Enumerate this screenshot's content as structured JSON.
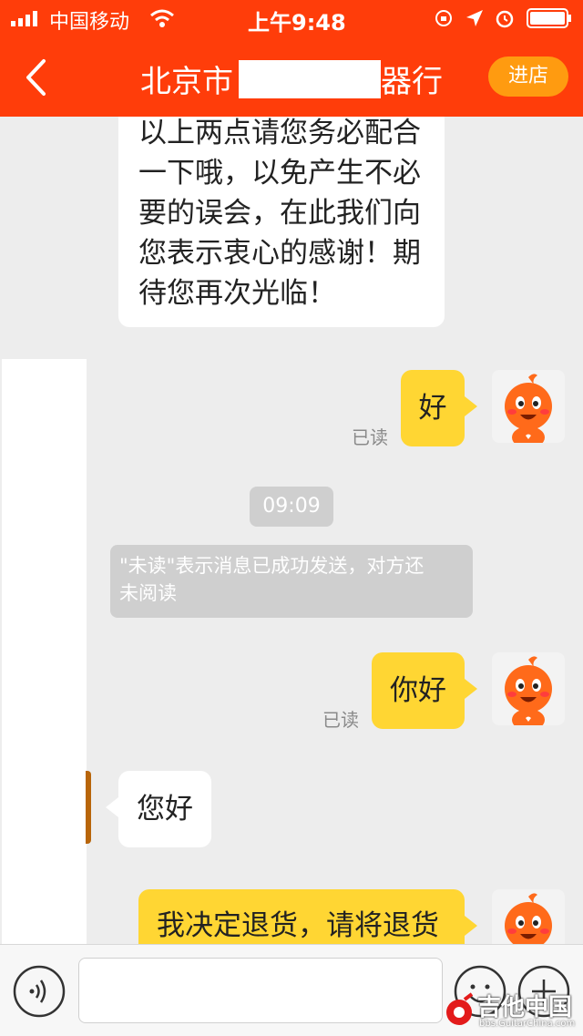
{
  "status_bar": {
    "carrier": "中国移动",
    "time": "上午9:48"
  },
  "nav": {
    "back_icon": "chevron-left-icon",
    "title_prefix": "北京市",
    "title_suffix": "器行",
    "enter_store_label": "进店"
  },
  "messages": {
    "first_white": [
      "以上两点请您务必配合",
      "一下哦，以免产生不必",
      "要的误会，在此我们向",
      "您表示衷心的感谢！期",
      "待您再次光临！"
    ],
    "msg1_text": "好",
    "msg1_read": "已读",
    "time_separator": "09:09",
    "notice_lines": [
      "\"未读\"表示消息已成功发送，对方还",
      "未阅读"
    ],
    "msg2_text": "你好",
    "msg2_read": "已读",
    "reply_text": "您好",
    "msg3_text": "我决定退货，请将退货"
  },
  "input": {
    "voice_icon": "voice-icon",
    "emoji_icon": "emoji-icon",
    "plus_icon": "plus-icon"
  },
  "watermark": {
    "title": "吉他中国",
    "url": "bbs.GuitarChina.com"
  },
  "colors": {
    "brand": "#ff3d0a",
    "bubble_yellow": "#ffd633",
    "enter_button": "#ff9b10"
  }
}
